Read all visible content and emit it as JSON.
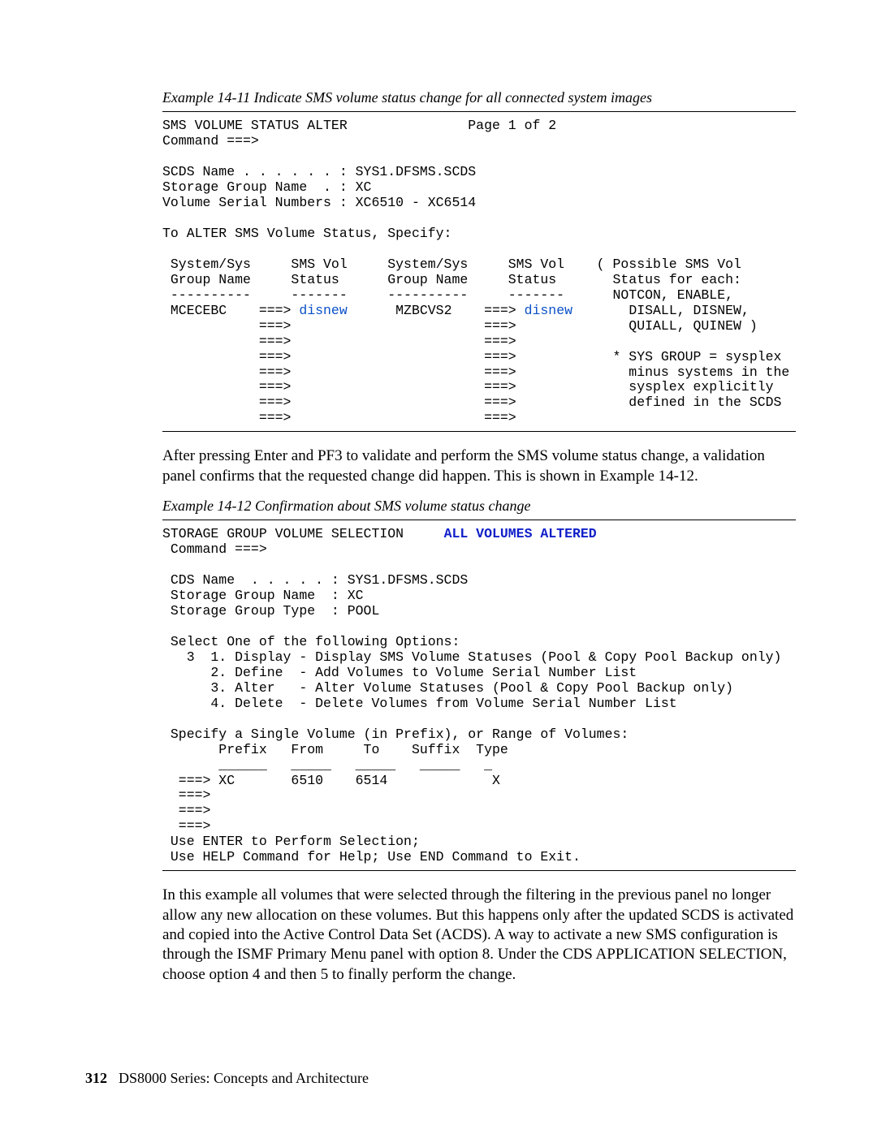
{
  "ex1": {
    "caption": "Example 14-11   Indicate SMS volume status change for all connected system images",
    "header": "SMS VOLUME STATUS ALTER               Page 1 of 2",
    "cmd": "Command ===>",
    "scds": "SCDS Name . . . . . . : SYS1.DFSMS.SCDS",
    "sg": "Storage Group Name  . : XC",
    "vsn": "Volume Serial Numbers : XC6510 - XC6514",
    "instr": "To ALTER SMS Volume Status, Specify:",
    "th1": " System/Sys     SMS Vol     System/Sys     SMS Vol    ( Possible SMS Vol",
    "th2": " Group Name     Status      Group Name     Status       Status for each:",
    "th3": " ----------     -------     ----------     -------      NOTCON, ENABLE,",
    "r1a": " MCECEBC    ===> ",
    "r1hl1": "disnew",
    "r1b": "      MZBCVS2    ===> ",
    "r1hl2": "disnew",
    "r1c": "       DISALL, DISNEW,",
    "r2": "            ===>                        ===>              QUIALL, QUINEW )",
    "r3": "            ===>                        ===>",
    "r4": "            ===>                        ===>            * SYS GROUP = sysplex",
    "r5": "            ===>                        ===>              minus systems in the",
    "r6": "            ===>                        ===>              sysplex explicitly",
    "r7": "            ===>                        ===>              defined in the SCDS",
    "r8": "            ===>                        ===>"
  },
  "para1": "After pressing Enter and PF3 to validate and perform the SMS volume status change, a validation panel confirms that the requested change did happen. This is shown in Example 14-12.",
  "ex2": {
    "caption": "Example 14-12   Confirmation about SMS volume status change",
    "hdr_a": "STORAGE GROUP VOLUME SELECTION     ",
    "hdr_b": "ALL VOLUMES ALTERED",
    "cmd": " Command ===>",
    "cds": " CDS Name  . . . . . : SYS1.DFSMS.SCDS",
    "sg": " Storage Group Name  : XC",
    "sgt": " Storage Group Type  : POOL",
    "sel": " Select One of the following Options:",
    "opt1": "   3  1. Display - Display SMS Volume Statuses (Pool & Copy Pool Backup only)",
    "opt2": "      2. Define  - Add Volumes to Volume Serial Number List",
    "opt3": "      3. Alter   - Alter Volume Statuses (Pool & Copy Pool Backup only)",
    "opt4": "      4. Delete  - Delete Volumes from Volume Serial Number List",
    "spec": " Specify a Single Volume (in Prefix), or Range of Volumes:",
    "cols": "       Prefix   From     To    Suffix  Type",
    "ul": "       ______   _____   _____   _____   _",
    "l1": "  ===> XC       6510    6514             X",
    "l2": "  ===>",
    "l3": "  ===>",
    "l4": "  ===>",
    "f1": " Use ENTER to Perform Selection;",
    "f2": " Use HELP Command for Help; Use END Command to Exit."
  },
  "para2": "In this example all volumes that were selected through the filtering in the previous panel no longer allow any new allocation on these volumes. But this happens only after the updated SCDS is activated and copied into the Active Control Data Set (ACDS). A way to activate a new SMS configuration is through the ISMF Primary Menu panel with option 8. Under the CDS APPLICATION SELECTION, choose option 4 and then 5 to finally perform the change.",
  "footer": {
    "page": "312",
    "title": "DS8000 Series: Concepts and Architecture"
  }
}
